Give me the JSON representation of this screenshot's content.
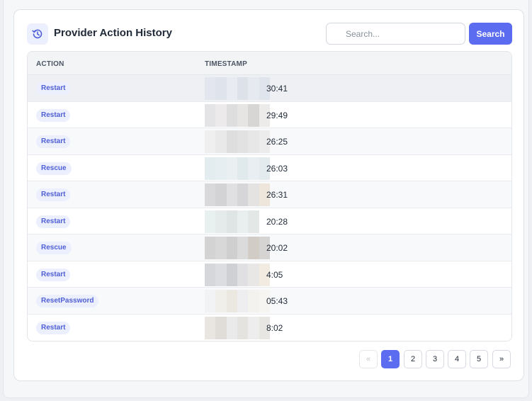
{
  "header": {
    "title": "Provider Action History",
    "icon": "history-icon"
  },
  "search": {
    "placeholder": "Search...",
    "button_label": "Search"
  },
  "table": {
    "columns": [
      "ACTION",
      "TIMESTAMP"
    ],
    "rows": [
      {
        "action": "Restart",
        "timestamp_visible": "30:41"
      },
      {
        "action": "Restart",
        "timestamp_visible": "29:49"
      },
      {
        "action": "Restart",
        "timestamp_visible": "26:25"
      },
      {
        "action": "Rescue",
        "timestamp_visible": "26:03"
      },
      {
        "action": "Restart",
        "timestamp_visible": "26:31"
      },
      {
        "action": "Restart",
        "timestamp_visible": "20:28"
      },
      {
        "action": "Rescue",
        "timestamp_visible": "20:02"
      },
      {
        "action": "Restart",
        "timestamp_visible": "4:05"
      },
      {
        "action": "ResetPassword",
        "timestamp_visible": "05:43"
      },
      {
        "action": "Restart",
        "timestamp_visible": "8:02"
      }
    ]
  },
  "pagination": {
    "prev": "«",
    "pages": [
      "1",
      "2",
      "3",
      "4",
      "5"
    ],
    "next": "»",
    "current": "1"
  },
  "colors": {
    "accent": "#5b6cf0",
    "badge_bg": "#eceffd",
    "badge_text": "#4f5fd6"
  }
}
